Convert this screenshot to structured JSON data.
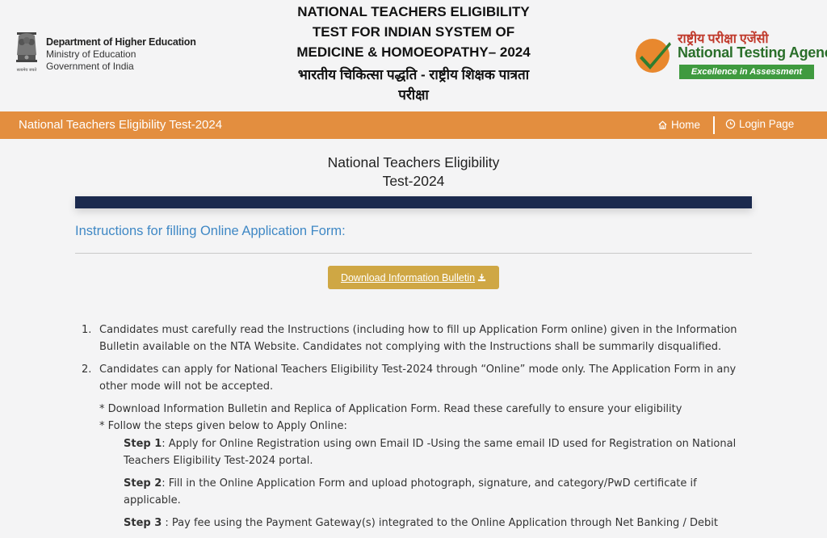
{
  "header": {
    "dept": {
      "line1": "Department of Higher Education",
      "line2": "Ministry of Education",
      "line3": "Government of India",
      "emblem_motto": "सत्यमेव जयते"
    },
    "title_en": "NATIONAL TEACHERS ELIGIBILITY TEST FOR INDIAN SYSTEM OF MEDICINE & HOMOEOPATHY– 2024",
    "title_hi": "भारतीय चिकित्सा पद्धति - राष्ट्रीय शिक्षक पात्रता परीक्षा",
    "nta": {
      "hindi": "राष्ट्रीय परीक्षा एजेंसी",
      "english": "National Testing Agency",
      "tagline": "Excellence in Assessment"
    }
  },
  "navbar": {
    "title": "National Teachers Eligibility Test-2024",
    "home": "Home",
    "login": "Login Page"
  },
  "main": {
    "heading_line1": "National Teachers Eligibility",
    "heading_line2": "Test-2024",
    "section_title": "Instructions for filling Online Application Form:",
    "download_button": "Download Information Bulletin",
    "instructions": [
      {
        "num": "1.",
        "text": "Candidates must carefully read the Instructions (including how to fill up Application Form online) given in the Information Bulletin available on the NTA Website. Candidates not complying with the Instructions shall be summarily disqualified."
      },
      {
        "num": "2.",
        "text": "Candidates can apply for National Teachers Eligibility Test-2024 through “Online” mode only. The Application Form in any other mode will not be accepted."
      }
    ],
    "notes": [
      "* Download Information Bulletin and Replica of Application Form. Read these carefully to ensure your eligibility",
      "* Follow the steps given below to Apply Online:"
    ],
    "steps": [
      {
        "label": "Step 1",
        "text": ": Apply for Online Registration using own Email ID -Using the same email ID used for Registration on National Teachers Eligibility Test-2024 portal."
      },
      {
        "label": "Step 2",
        "text": ": Fill in the Online Application Form and upload photograph, signature, and category/PwD certificate if applicable."
      },
      {
        "label": "Step 3",
        "text": " : Pay fee using the Payment Gateway(s) integrated to the Online Application through Net Banking / Debit"
      }
    ]
  },
  "colors": {
    "navbar": "#e38e3f",
    "dark_bar": "#1b2a4e",
    "section_title": "#3f88c5",
    "download_button": "#cfa744",
    "nta_green": "#3f9a3f"
  }
}
